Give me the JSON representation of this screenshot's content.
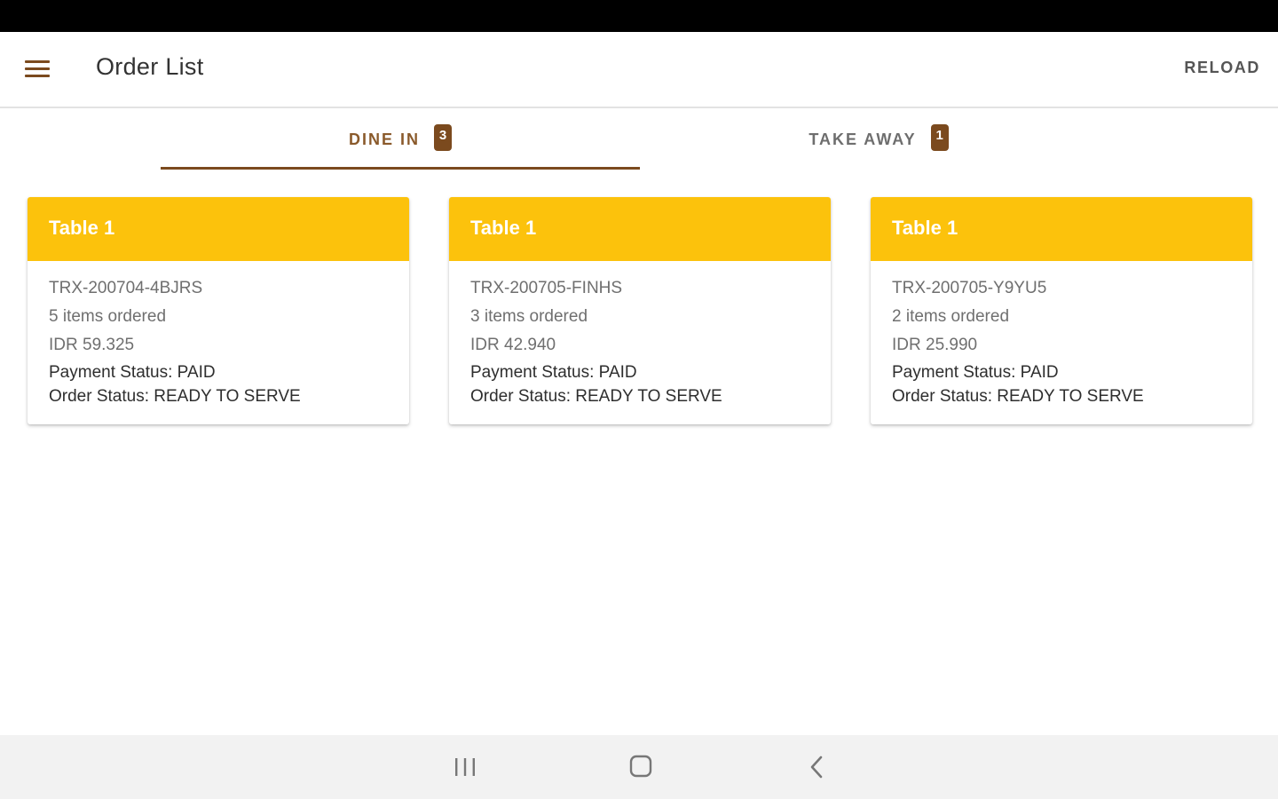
{
  "app_bar": {
    "title": "Order List",
    "reload_label": "RELOAD"
  },
  "tabs": [
    {
      "label": "DINE IN",
      "badge": "3",
      "selected": true
    },
    {
      "label": "TAKE AWAY",
      "badge": "1",
      "selected": false
    }
  ],
  "orders": [
    {
      "table": "Table 1",
      "trx_id": "TRX-200704-4BJRS",
      "items": "5 items ordered",
      "price": "IDR 59.325",
      "payment_status": "Payment Status: PAID",
      "order_status": "Order Status: READY TO SERVE"
    },
    {
      "table": "Table 1",
      "trx_id": "TRX-200705-FINHS",
      "items": "3 items ordered",
      "price": "IDR 42.940",
      "payment_status": "Payment Status: PAID",
      "order_status": "Order Status: READY TO SERVE"
    },
    {
      "table": "Table 1",
      "trx_id": "TRX-200705-Y9YU5",
      "items": "2 items ordered",
      "price": "IDR 25.990",
      "payment_status": "Payment Status: PAID",
      "order_status": "Order Status: READY TO SERVE"
    }
  ],
  "colors": {
    "accent": "#7b4a1e",
    "card_header": "#fcc20c",
    "status_bar": "#000000",
    "nav_bar": "#f2f2f2"
  },
  "icons": {
    "menu": "menu-icon",
    "recents": "recents-icon",
    "home": "home-icon",
    "back": "back-icon"
  }
}
